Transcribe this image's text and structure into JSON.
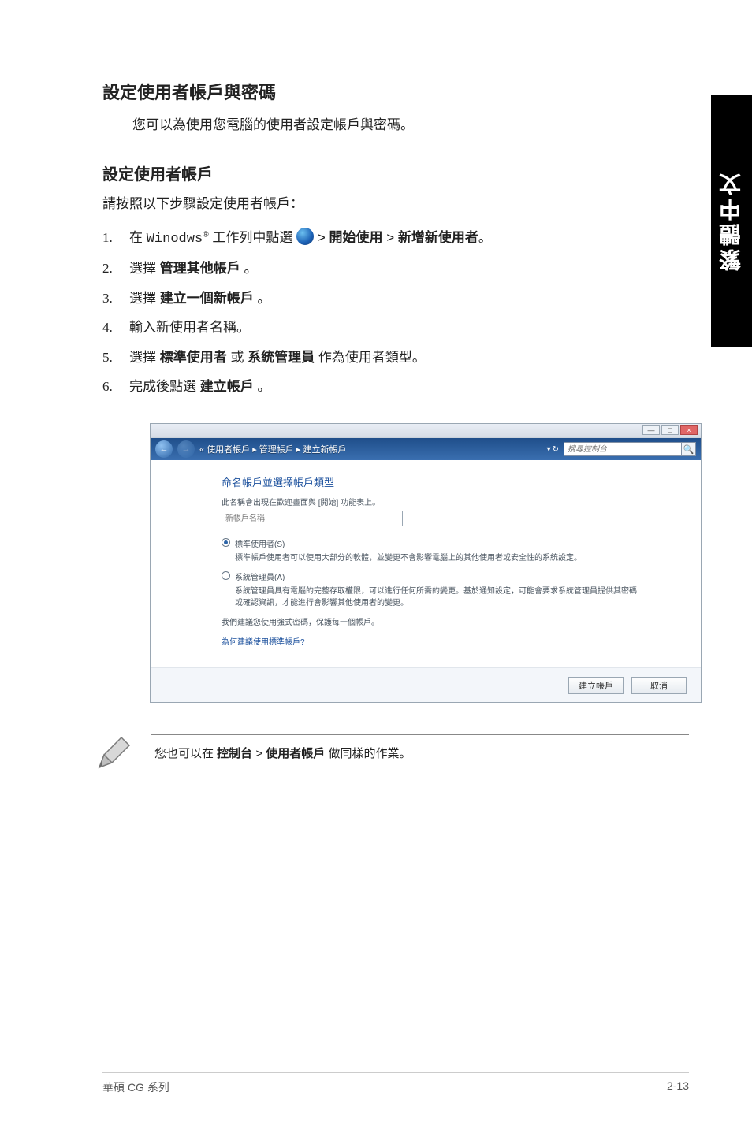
{
  "sideTab": "繁體中文",
  "mainTitle": "設定使用者帳戶與密碼",
  "intro": "您可以為使用您電腦的使用者設定帳戶與密碼。",
  "subTitle": "設定使用者帳戶",
  "subIntro": "請按照以下步驟設定使用者帳戶：",
  "steps": {
    "s1": {
      "num": "1.",
      "pre": "在 ",
      "code": "Winodws",
      "post1": " 工作列中點選 ",
      "post2": " > ",
      "bold1": "開始使用",
      "post3": " > ",
      "bold2": "新增新使用者",
      "post4": "。"
    },
    "s2": {
      "num": "2.",
      "pre": "選擇 ",
      "bold": "管理其他帳戶",
      "post": " 。"
    },
    "s3": {
      "num": "3.",
      "pre": "選擇 ",
      "bold": "建立一個新帳戶",
      "post": " 。"
    },
    "s4": {
      "num": "4.",
      "text": "輸入新使用者名稱。"
    },
    "s5": {
      "num": "5.",
      "pre": "選擇 ",
      "bold1": "標準使用者",
      "mid": " 或 ",
      "bold2": "系統管理員",
      "post": " 作為使用者類型。"
    },
    "s6": {
      "num": "6.",
      "pre": "完成後點選 ",
      "bold": "建立帳戶",
      "post": " 。"
    }
  },
  "shot": {
    "wctl": {
      "min": "—",
      "max": "□",
      "close": "×"
    },
    "nav": {
      "back": "←",
      "fwd": "→"
    },
    "crumbs": "« 使用者帳戶 ▸ 管理帳戶 ▸ 建立新帳戶",
    "search": {
      "drop": "▾",
      "refresh": "↻",
      "placeholder": "搜尋控制台",
      "mag": "🔍"
    },
    "heading": "命名帳戶並選擇帳戶類型",
    "subline": "此名稱會出現在歡迎畫面與 [開始] 功能表上。",
    "inputPlaceholder": "新帳戶名稱",
    "opt1": {
      "label": "標準使用者(S)",
      "desc": "標準帳戶使用者可以使用大部分的軟體，並變更不會影響電腦上的其他使用者或安全性的系統設定。"
    },
    "opt2": {
      "label": "系統管理員(A)",
      "desc": "系統管理員具有電腦的完整存取權限，可以進行任何所需的變更。基於通知設定，可能會要求系統管理員提供其密碼或確認資訊，才能進行會影響其他使用者的變更。"
    },
    "reco": "我們建議您使用強式密碼，保護每一個帳戶。",
    "link": "為何建議使用標準帳戶?",
    "btnCreate": "建立帳戶",
    "btnCancel": "取消"
  },
  "note": {
    "pre": "您也可以在 ",
    "b1": "控制台",
    "sep": " > ",
    "b2": "使用者帳戶",
    "post": " 做同樣的作業。"
  },
  "footer": {
    "left": "華碩 CG 系列",
    "right": "2-13"
  }
}
